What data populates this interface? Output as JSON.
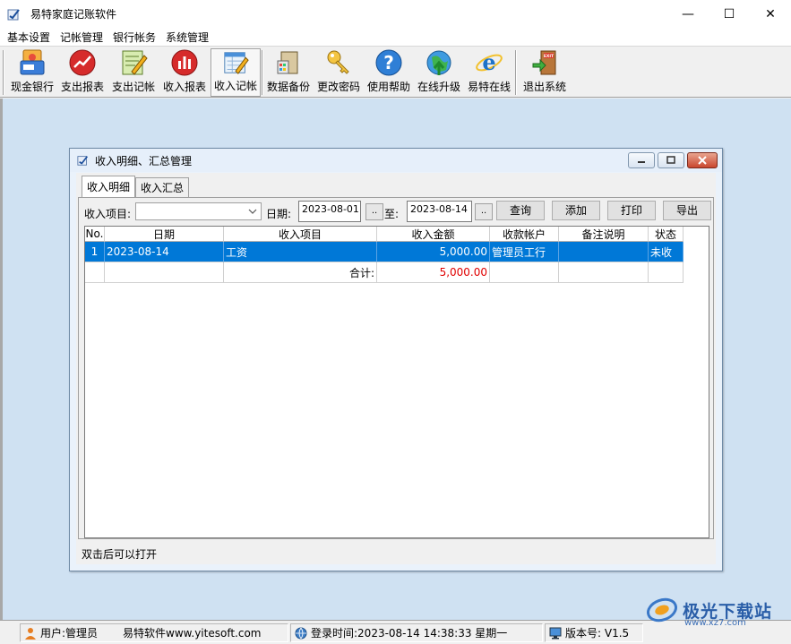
{
  "window": {
    "title": "易特家庭记账软件",
    "min": "—",
    "max": "☐",
    "close": "✕"
  },
  "menu": [
    "基本设置",
    "记帐管理",
    "银行帐务",
    "系统管理"
  ],
  "toolbar": [
    {
      "label": "现金银行",
      "icon": "cash-bank-icon"
    },
    {
      "label": "支出报表",
      "icon": "expense-report-icon"
    },
    {
      "label": "支出记帐",
      "icon": "expense-entry-icon"
    },
    {
      "label": "收入报表",
      "icon": "income-report-icon"
    },
    {
      "label": "收入记帐",
      "icon": "income-entry-icon",
      "pressed": true
    },
    {
      "label": "数据备份",
      "icon": "backup-icon"
    },
    {
      "label": "更改密码",
      "icon": "key-icon"
    },
    {
      "label": "使用帮助",
      "icon": "help-icon"
    },
    {
      "label": "在线升级",
      "icon": "upgrade-icon"
    },
    {
      "label": "易特在线",
      "icon": "ie-icon"
    },
    {
      "label": "退出系统",
      "icon": "exit-icon"
    }
  ],
  "child": {
    "title": "收入明细、汇总管理",
    "tabs": [
      "收入明细",
      "收入汇总"
    ],
    "filter": {
      "item_label": "收入项目:",
      "item_value": "",
      "date_label": "日期:",
      "date_from": "2023-08-01",
      "to_label": "至:",
      "date_to": "2023-08-14",
      "dots": "..",
      "query": "查询",
      "add": "添加",
      "print": "打印",
      "export": "导出"
    },
    "table": {
      "headers": [
        "No.",
        "日期",
        "收入项目",
        "收入金额",
        "收款帐户",
        "备注说明",
        "状态"
      ],
      "rows": [
        [
          "1",
          "2023-08-14",
          "工资",
          "5,000.00",
          "管理员工行",
          "",
          "未收"
        ]
      ],
      "total": {
        "label": "合计:",
        "value": "5,000.00"
      }
    },
    "hint": "双击后可以打开"
  },
  "statusbar": {
    "user": "用户:管理员",
    "site": "易特软件www.yitesoft.com",
    "login": "登录时间:2023-08-14 14:38:33 星期一",
    "version": "版本号: V1.5"
  },
  "watermark": {
    "text": "极光下载站",
    "url": "www.xz7.com"
  },
  "colors": {
    "selection": "#0078d7",
    "mdi_bg": "#cfe1f2",
    "total_red": "#e00000"
  }
}
